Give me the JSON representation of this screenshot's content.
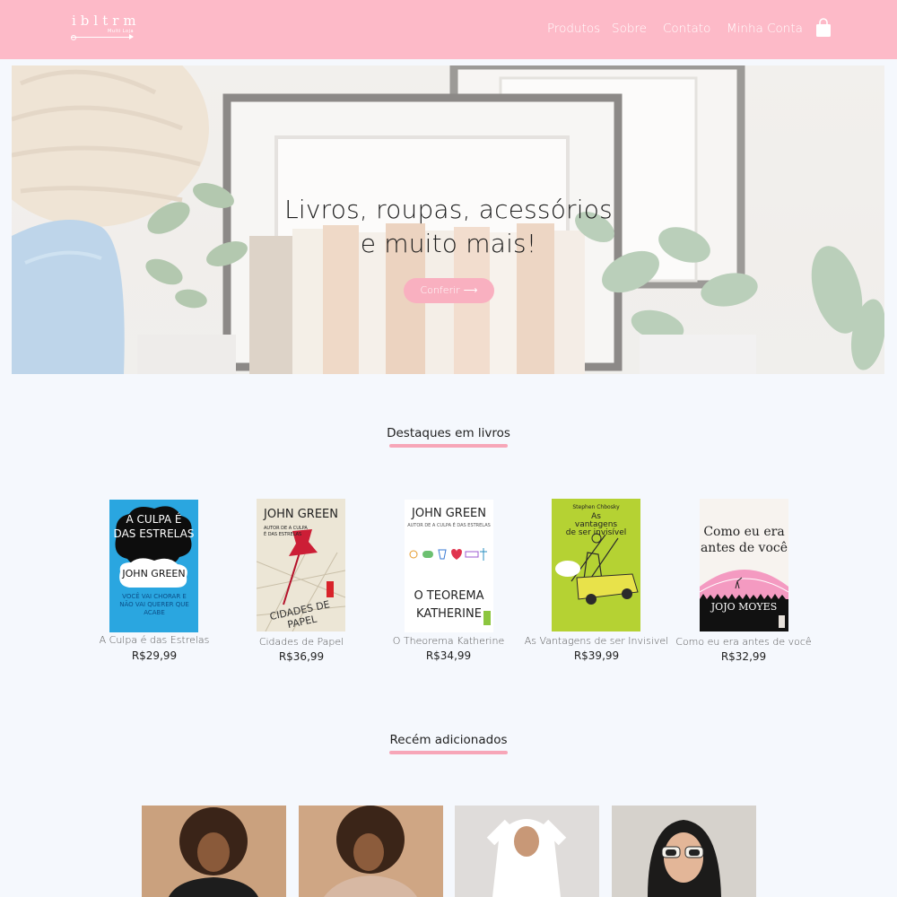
{
  "header": {
    "logo_name": "ibltrm",
    "logo_tag": "Multi Loja",
    "nav": [
      "Produtos",
      "Sobre",
      "Contato",
      "Minha Conta"
    ],
    "cart_icon": "shopping-bag-icon",
    "color": "#fdbac8"
  },
  "hero": {
    "title_line1": "Livros, roupas, acessórios",
    "title_line2": "e muito mais!",
    "button_label": "Conferir",
    "button_arrow": "⟶",
    "button_color": "#f9b0c0"
  },
  "featured": {
    "title": "Destaques em livros",
    "books": [
      {
        "title": "A Culpa é das Estrelas",
        "price": "R$29,99",
        "cover": {
          "line1": "A CULPA É",
          "line2": "DAS ESTRELAS",
          "author": "JOHN GREEN",
          "quote": "VOCÊ VAI CHORAR E NÃO VAI QUERER QUE ACABE"
        }
      },
      {
        "title": "Cidades de Papel",
        "price": "R$36,99",
        "cover": {
          "author": "JOHN GREEN",
          "subtitle": "AUTOR DE A CULPA É DAS ESTRELAS",
          "title": "CIDADES DE PAPEL",
          "brand": "i"
        }
      },
      {
        "title": "O Theorema Katherine",
        "price": "R$34,99",
        "cover": {
          "author": "JOHN GREEN",
          "subtitle": "AUTOR DE A CULPA É DAS ESTRELAS",
          "line1": "O TEOREMA",
          "line2": "KATHERINE",
          "brand": "i"
        }
      },
      {
        "title": "As Vantagens de ser Invisivel",
        "price": "R$39,99",
        "cover": {
          "author": "Stephen Chbosky",
          "line1": "As",
          "line2": "vantagens",
          "line3": "de ser invisível"
        }
      },
      {
        "title": "Como eu era antes de você",
        "price": "R$32,99",
        "cover": {
          "line1": "Como eu era",
          "line2": "antes de você",
          "author": "JOJO MOYES",
          "brand": "i"
        }
      }
    ]
  },
  "recent": {
    "title": "Recém adicionados"
  },
  "colors": {
    "accent": "#f7a6b8",
    "background": "#f5f8fd"
  }
}
